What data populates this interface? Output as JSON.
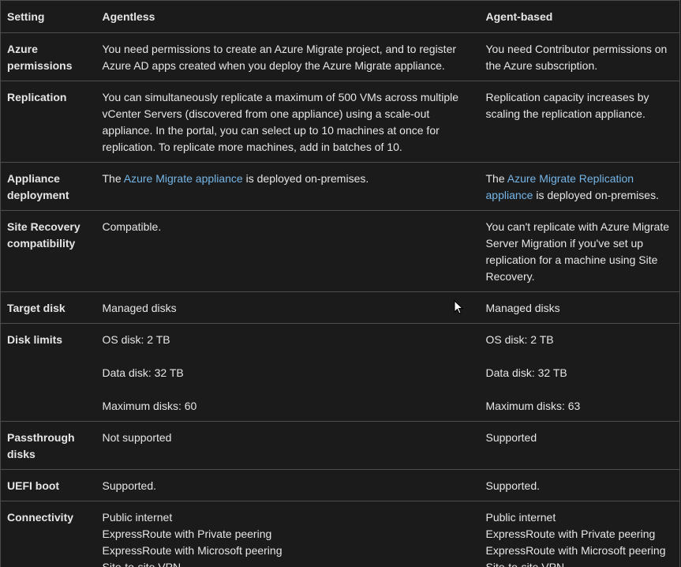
{
  "headers": {
    "setting": "Setting",
    "agentless": "Agentless",
    "agent_based": "Agent-based"
  },
  "rows": [
    {
      "setting": "Azure permissions",
      "agentless": "You need permissions to create an Azure Migrate project, and to register Azure AD apps created when you deploy the Azure Migrate appliance.",
      "agent_based": "You need Contributor permissions on the Azure subscription."
    },
    {
      "setting": "Replication",
      "agentless": "You can simultaneously replicate a maximum of 500 VMs across multiple vCenter Servers (discovered from one appliance) using a scale-out appliance. In the portal, you can select up to 10 machines at once for replication. To replicate more machines, add in batches of 10.",
      "agent_based": "Replication capacity increases by scaling the replication appliance."
    },
    {
      "setting": "Appliance deployment",
      "agentless": {
        "pre": "The ",
        "link": "Azure Migrate appliance",
        "post": " is deployed on-premises."
      },
      "agent_based": {
        "pre": "The ",
        "link": "Azure Migrate Replication appliance",
        "post": " is deployed on-premises."
      }
    },
    {
      "setting": "Site Recovery compatibility",
      "agentless": "Compatible.",
      "agent_based": "You can't replicate with Azure Migrate Server Migration if you've set up replication for a machine using Site Recovery."
    },
    {
      "setting": "Target disk",
      "agentless": "Managed disks",
      "agent_based": "Managed disks"
    },
    {
      "setting": "Disk limits",
      "agentless": [
        "OS disk: 2 TB",
        "Data disk: 32 TB",
        "Maximum disks: 60"
      ],
      "agent_based": [
        "OS disk: 2 TB",
        "Data disk: 32 TB",
        "Maximum disks: 63"
      ]
    },
    {
      "setting": "Passthrough disks",
      "agentless": "Not supported",
      "agent_based": "Supported"
    },
    {
      "setting": "UEFI boot",
      "agentless": "Supported.",
      "agent_based": "Supported."
    },
    {
      "setting": "Connectivity",
      "agentless": [
        "Public internet",
        "ExpressRoute with Private peering",
        "ExpressRoute with Microsoft peering",
        "Site-to-site VPN"
      ],
      "agent_based": [
        "Public internet",
        "ExpressRoute with Private peering",
        "ExpressRoute with Microsoft peering",
        "Site-to-site VPN"
      ]
    }
  ],
  "colors": {
    "background": "#1b1b1b",
    "text": "#e6e6e6",
    "link": "#75b6e7",
    "border": "#4d4d4d"
  },
  "icons": {
    "cursor": "mouse-pointer-icon"
  }
}
